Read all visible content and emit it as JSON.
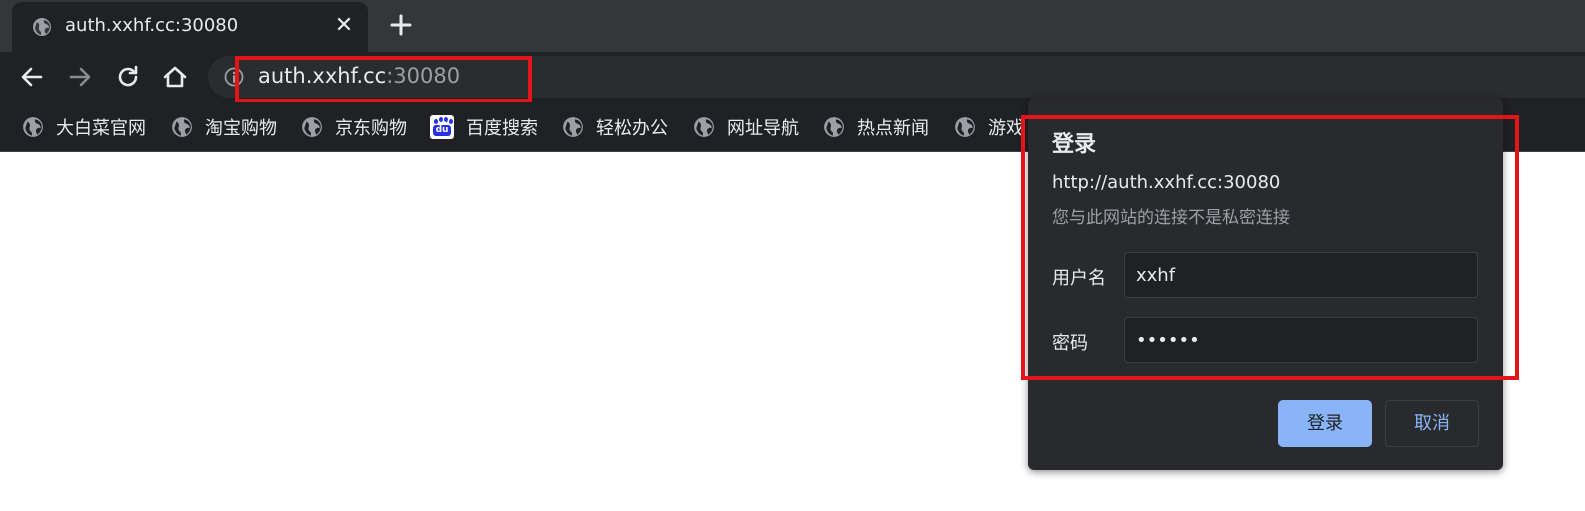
{
  "tab": {
    "title": "auth.xxhf.cc:30080",
    "close_glyph": "✕",
    "favicon": "globe-icon"
  },
  "toolbar": {
    "back": "back-arrow-icon",
    "forward": "forward-arrow-icon",
    "reload": "reload-icon",
    "home": "home-icon"
  },
  "omnibox": {
    "host": "auth.xxhf.cc",
    "port": ":30080",
    "info_icon": "info-icon"
  },
  "bookmarks": [
    {
      "label": "大白菜官网",
      "icon": "globe-icon"
    },
    {
      "label": "淘宝购物",
      "icon": "globe-icon"
    },
    {
      "label": "京东购物",
      "icon": "globe-icon"
    },
    {
      "label": "百度搜索",
      "icon": "baidu-icon"
    },
    {
      "label": "轻松办公",
      "icon": "globe-icon"
    },
    {
      "label": "网址导航",
      "icon": "globe-icon"
    },
    {
      "label": "热点新闻",
      "icon": "globe-icon"
    },
    {
      "label": "游戏",
      "icon": "globe-icon"
    }
  ],
  "dialog": {
    "title": "登录",
    "origin": "http://auth.xxhf.cc:30080",
    "warning": "您与此网站的连接不是私密连接",
    "username_label": "用户名",
    "username_value": "xxhf",
    "password_label": "密码",
    "password_value": "xxxxxx",
    "login_button": "登录",
    "cancel_button": "取消"
  },
  "colors": {
    "annotation": "#e3151a",
    "accent": "#8ab4f8",
    "chrome_dark": "#202124"
  }
}
